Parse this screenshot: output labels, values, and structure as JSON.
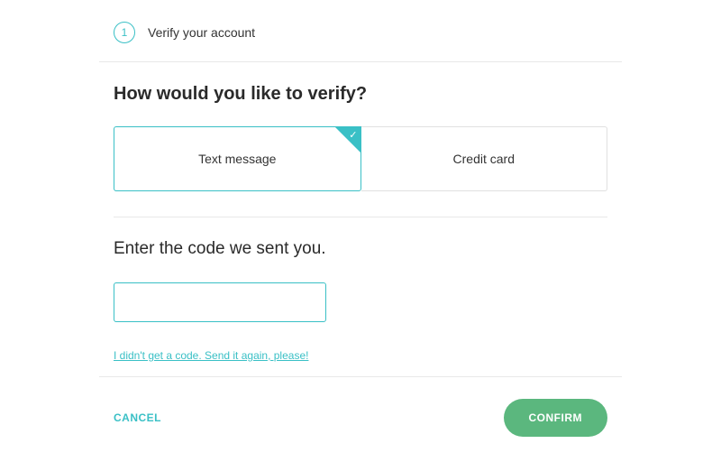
{
  "step": {
    "number": "1",
    "title": "Verify your account"
  },
  "verifySection": {
    "heading": "How would you like to verify?",
    "methods": {
      "textMessage": "Text message",
      "creditCard": "Credit card"
    }
  },
  "codeSection": {
    "heading": "Enter the code we sent you.",
    "inputValue": "",
    "resendLink": "I didn't get a code. Send it again, please!"
  },
  "footer": {
    "cancel": "CANCEL",
    "confirm": "CONFIRM"
  }
}
